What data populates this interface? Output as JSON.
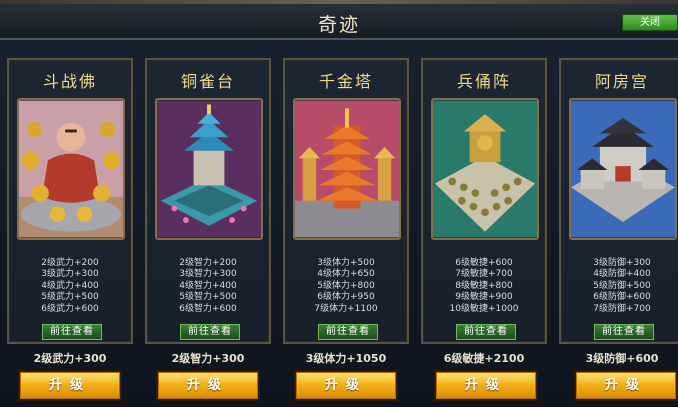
{
  "window": {
    "title": "奇迹",
    "close_label": "关闭"
  },
  "cards": [
    {
      "name": "斗战佛",
      "bonuses": [
        "2级武力+200",
        "3级武力+300",
        "4级武力+400",
        "5级武力+500",
        "6级武力+600"
      ],
      "goto_label": "前往查看",
      "current": "2级武力+300",
      "upgrade_label": "升级",
      "theme": "#c8a04a"
    },
    {
      "name": "铜雀台",
      "bonuses": [
        "2级智力+200",
        "3级智力+300",
        "4级智力+400",
        "5级智力+500",
        "6级智力+600"
      ],
      "goto_label": "前往查看",
      "current": "2级智力+300",
      "upgrade_label": "升级",
      "theme": "#2a8fb0"
    },
    {
      "name": "千金塔",
      "bonuses": [
        "3级体力+500",
        "4级体力+650",
        "5级体力+800",
        "6级体力+950",
        "7级体力+1100"
      ],
      "goto_label": "前往查看",
      "current": "3级体力+1050",
      "upgrade_label": "升级",
      "theme": "#d04a2a"
    },
    {
      "name": "兵俑阵",
      "bonuses": [
        "6级敏捷+600",
        "7级敏捷+700",
        "8级敏捷+800",
        "9级敏捷+900",
        "10级敏捷+1000"
      ],
      "goto_label": "前往查看",
      "current": "6级敏捷+2100",
      "upgrade_label": "升级",
      "theme": "#4aa07a"
    },
    {
      "name": "阿房宫",
      "bonuses": [
        "3级防御+300",
        "4级防御+400",
        "5级防御+500",
        "6级防御+600",
        "7级防御+700"
      ],
      "goto_label": "前往查看",
      "current": "3级防御+600",
      "upgrade_label": "升级",
      "theme": "#3a6ac8"
    }
  ]
}
